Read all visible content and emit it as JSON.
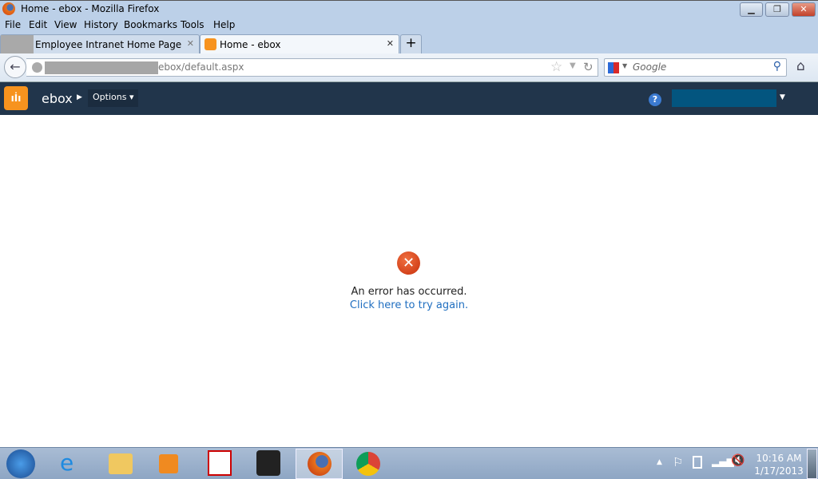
{
  "window": {
    "title": "Home - ebox - Mozilla Firefox"
  },
  "menu": [
    "File",
    "Edit",
    "View",
    "History",
    "Bookmarks",
    "Tools",
    "Help"
  ],
  "tabs": [
    {
      "label": "Employee Intranet Home Page",
      "active": false
    },
    {
      "label": "Home - ebox",
      "active": true
    }
  ],
  "nav": {
    "url": "ebox/default.aspx",
    "search_placeholder": "Google"
  },
  "app": {
    "name": "ebox",
    "options_label": "Options",
    "brand_color": "#f7931e",
    "header_color": "#21354b"
  },
  "error": {
    "message": "An error has occurred.",
    "retry_link": "Click here to try again."
  },
  "taskbar": {
    "time": "10:16 AM",
    "date": "1/17/2013"
  }
}
